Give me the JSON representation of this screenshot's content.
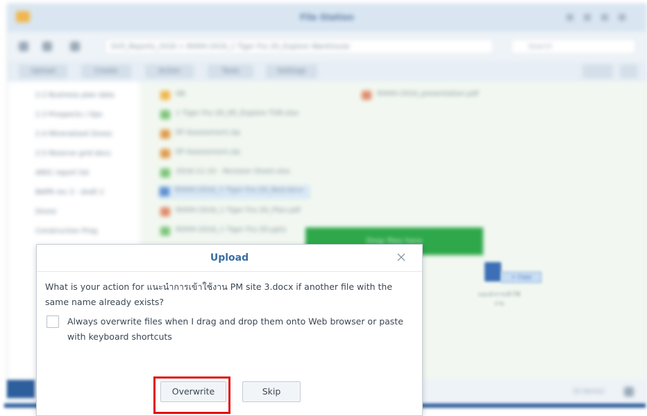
{
  "background": {
    "window_title": "File Station",
    "path": "Drill_Reports_2016 > RHHH-2016_1 Tiger Fra 2D_Explore Warehouse",
    "search_placeholder": "Search",
    "toolbar": [
      "Upload",
      "Create",
      "Action",
      "Tools",
      "Settings"
    ],
    "sidebar_items": [
      "2.2 Business plan data",
      "2.3 Prospects / Ops",
      "2.4 Mineralized Zones",
      "2.5 Reserve grid docs",
      "AM/C report list",
      "BAPR rev 3 - draft 2",
      "Drone",
      "Construction Prog"
    ],
    "files": [
      "AB",
      "1 Tiger Fra 2D_EE_Explore TOR.xlsx",
      "EP Assessment.zip",
      "EP Assessment.zip",
      "2016-11-10 - Revision Sheet.xlsx",
      "RHHH-2016_1 Tiger Fra 2D_Bed.docx",
      "RHHH-2016_1 Tiger Fra 2D_Plan.pdf",
      "RHHH-2016_1 Tiger Fra 2D.pptx",
      "RHHH-2016_presentation.pdf"
    ],
    "drop_banner": "Drop files here",
    "drag_copy": "+ Copy",
    "drag_label": "แนะนำการเข้าใช้งาน",
    "status": "10 item(s)"
  },
  "dialog": {
    "title": "Upload",
    "close_icon": "close-icon",
    "question": "What is your action for แนะนำการเข้าใช้งาน PM site 3.docx if another file with the same name already exists?",
    "checkbox_label": "Always overwrite files when I drag and drop them onto Web browser or paste with keyboard shortcuts",
    "checkbox_checked": false,
    "overwrite_label": "Overwrite",
    "skip_label": "Skip"
  },
  "colors": {
    "title_blue": "#3a6ea5",
    "highlight_red": "#e01010",
    "drop_green": "#2ea84a"
  }
}
